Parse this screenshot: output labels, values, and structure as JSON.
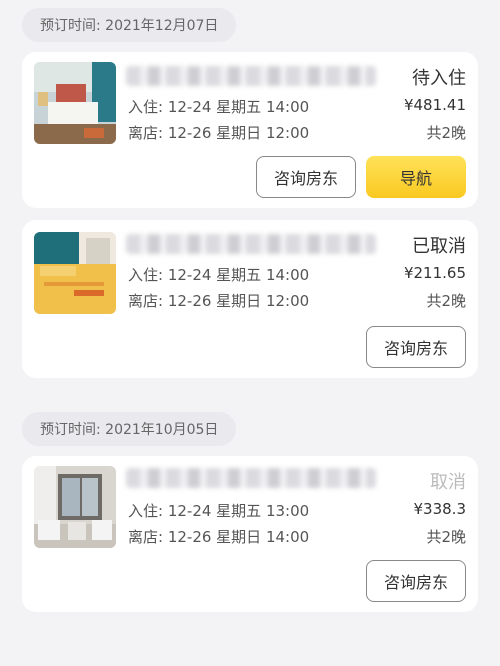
{
  "groups": [
    {
      "booking_date": "预订时间: 2021年12月07日",
      "orders": [
        {
          "status": "待入住",
          "check_in": "入住: 12-24 星期五 14:00",
          "check_out": "离店: 12-26 星期日 12:00",
          "price": "¥481.41",
          "nights": "共2晚",
          "consult_label": "咨询房东",
          "nav_label": "导航"
        }
      ]
    },
    {
      "orders": [
        {
          "status": "已取消",
          "check_in": "入住: 12-24 星期五 14:00",
          "check_out": "离店: 12-26 星期日 12:00",
          "price": "¥211.65",
          "nights": "共2晚",
          "consult_label": "咨询房东"
        }
      ]
    },
    {
      "booking_date": "预订时间: 2021年10月05日",
      "orders": [
        {
          "status": "取消",
          "check_in": "入住: 12-24 星期五 13:00",
          "check_out": "离店: 12-26 星期日 14:00",
          "price": "¥338.3",
          "nights": "共2晚",
          "consult_label": "咨询房东"
        }
      ]
    }
  ],
  "colors": {
    "accent_yellow": "#f9c920",
    "background": "#f3f3f5"
  }
}
